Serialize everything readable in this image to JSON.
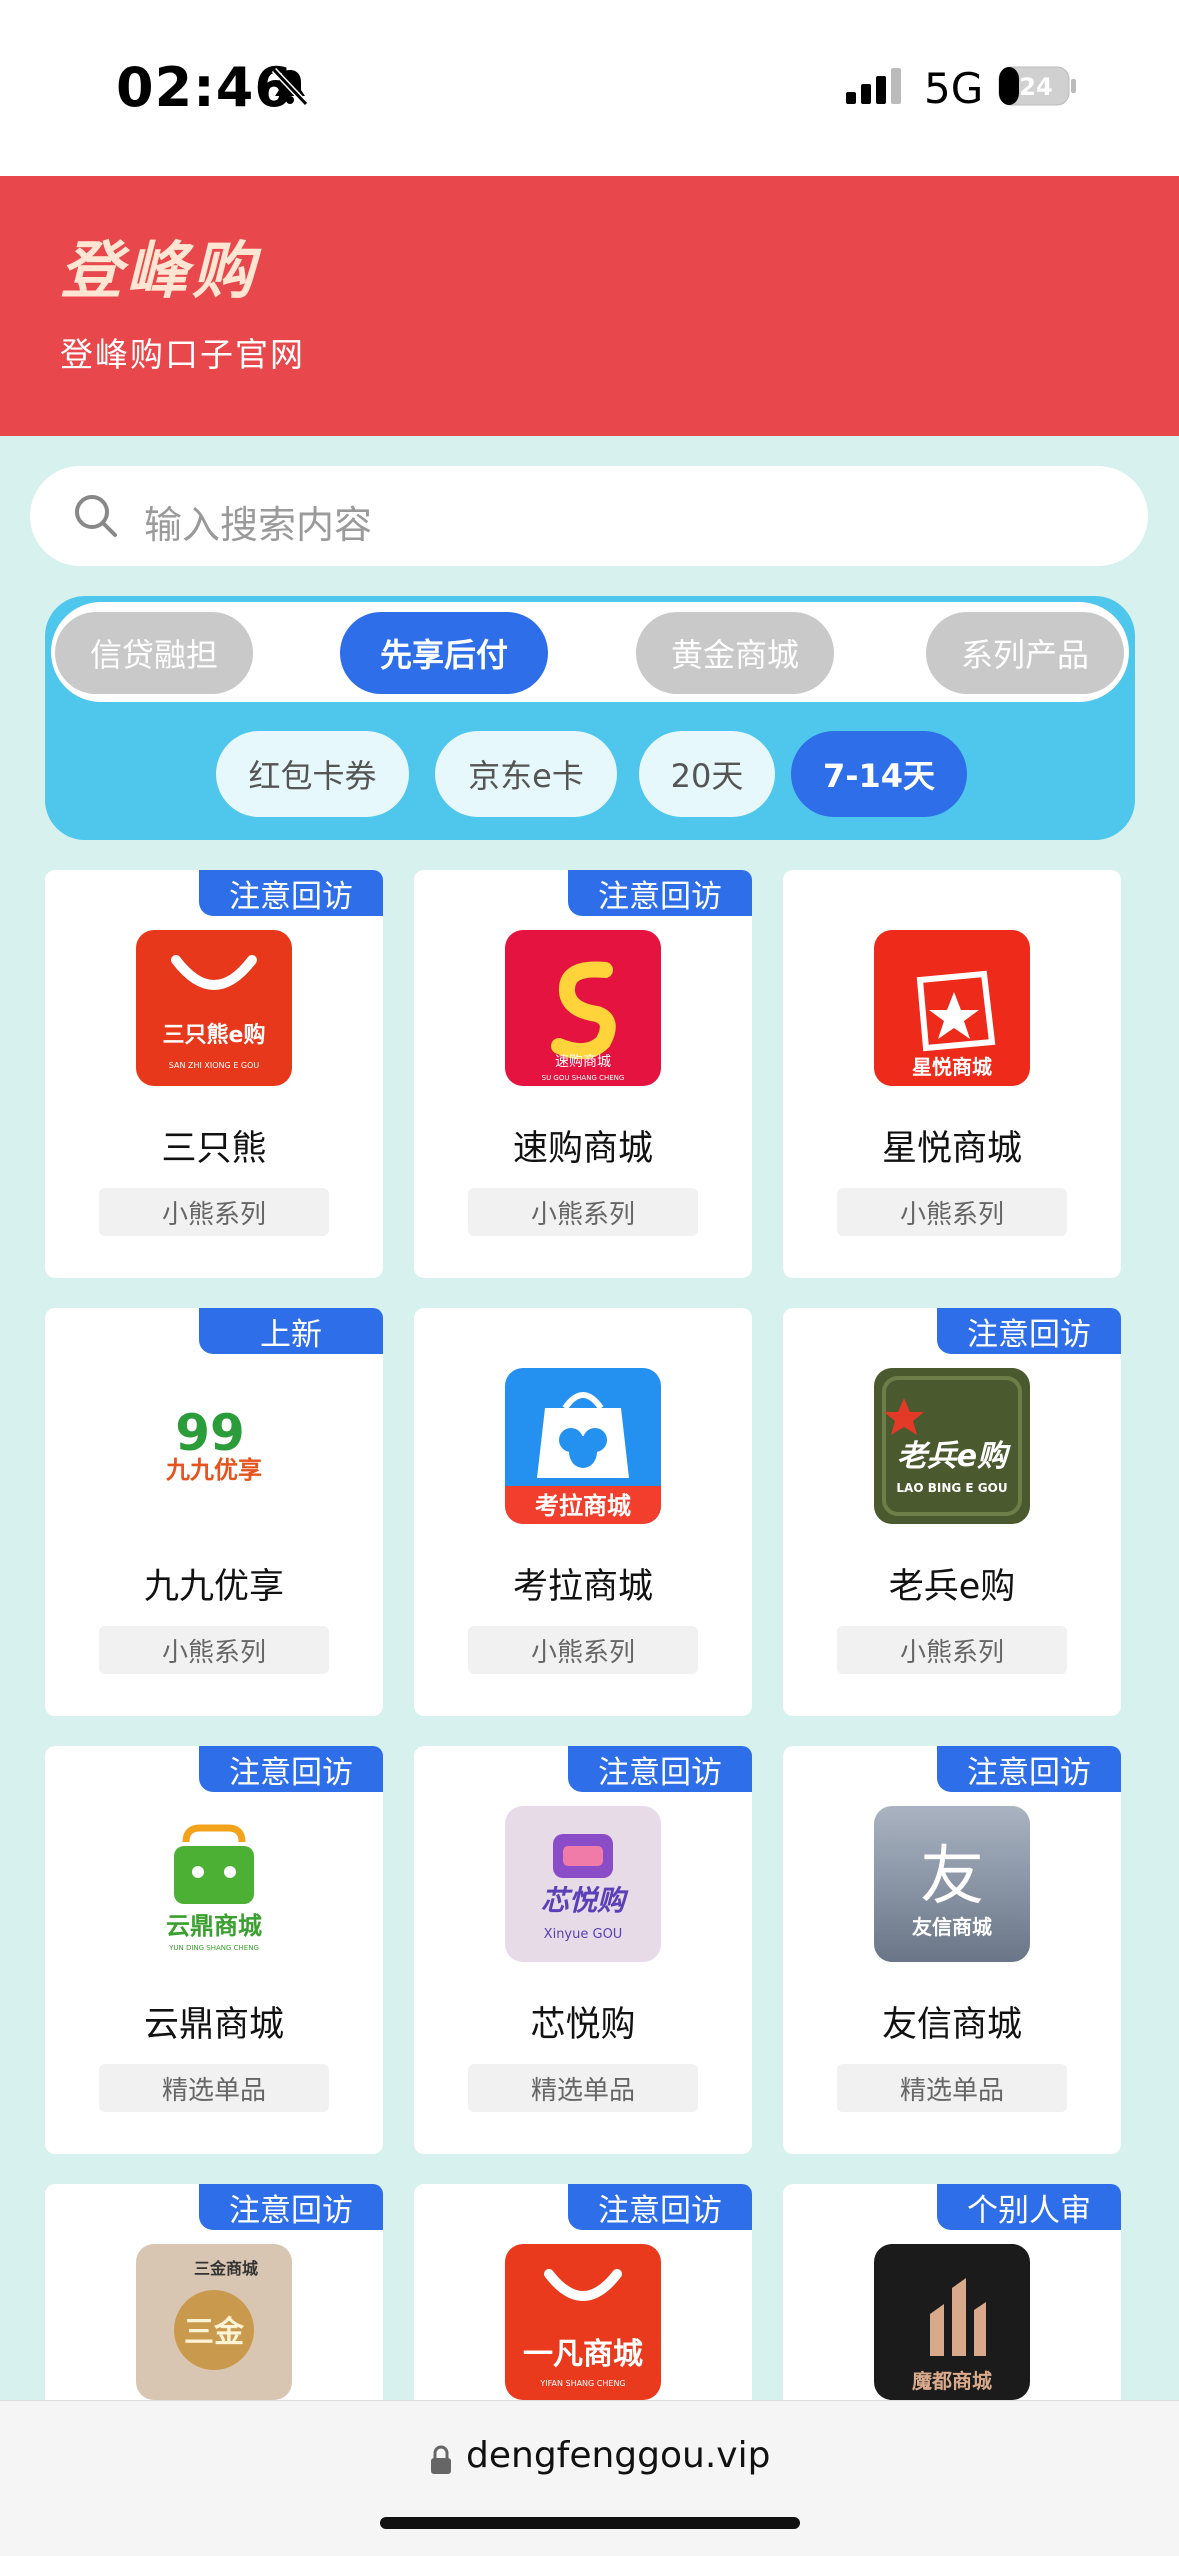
{
  "status_bar": {
    "time": "02:46",
    "network": "5G",
    "battery": "24"
  },
  "header": {
    "brand": "登峰购",
    "subtitle": "登峰购口子官网"
  },
  "search": {
    "placeholder": "输入搜索内容"
  },
  "tabs": [
    {
      "label": "信贷融担",
      "active": false
    },
    {
      "label": "先享后付",
      "active": true
    },
    {
      "label": "黄金商城",
      "active": false
    },
    {
      "label": "系列产品",
      "active": false
    }
  ],
  "subtabs": [
    {
      "label": "红包卡券",
      "active": false
    },
    {
      "label": "京东e卡",
      "active": false
    },
    {
      "label": "20天",
      "active": false
    },
    {
      "label": "7-14天",
      "active": true
    }
  ],
  "cards": [
    {
      "name": "三只熊",
      "tag": "注意回访",
      "series": "小熊系列",
      "logo_icon": "three-bears-logo-icon",
      "logo_text": "三只熊e购",
      "logo_sub": "SAN ZHI XIONG E GOU"
    },
    {
      "name": "速购商城",
      "tag": "注意回访",
      "series": "小熊系列",
      "logo_icon": "sugou-logo-icon",
      "logo_text": "速购商城",
      "logo_sub": "SU GOU SHANG CHENG"
    },
    {
      "name": "星悦商城",
      "tag": "",
      "series": "小熊系列",
      "logo_icon": "xingyue-logo-icon",
      "logo_text": "星悦商城"
    },
    {
      "name": "九九优享",
      "tag": "上新",
      "series": "小熊系列",
      "logo_icon": "jiujiu-logo-icon",
      "logo_text": "九九优享"
    },
    {
      "name": "考拉商城",
      "tag": "",
      "series": "小熊系列",
      "logo_icon": "koala-logo-icon",
      "logo_text": "考拉商城"
    },
    {
      "name": "老兵e购",
      "tag": "注意回访",
      "series": "小熊系列",
      "logo_icon": "laobing-logo-icon",
      "logo_text": "老兵e购",
      "logo_sub": "LAO BING E GOU"
    },
    {
      "name": "云鼎商城",
      "tag": "注意回访",
      "series": "精选单品",
      "logo_icon": "yunding-logo-icon",
      "logo_text": "云鼎商城",
      "logo_sub": "YUN DING SHANG CHENG"
    },
    {
      "name": "芯悦购",
      "tag": "注意回访",
      "series": "精选单品",
      "logo_icon": "xinyue-logo-icon",
      "logo_text": "芯悦购",
      "logo_sub": "Xinyue GOU"
    },
    {
      "name": "友信商城",
      "tag": "注意回访",
      "series": "精选单品",
      "logo_icon": "youxin-logo-icon",
      "logo_text": "友信商城"
    },
    {
      "name": "",
      "tag": "注意回访",
      "series": "",
      "logo_icon": "sanjin-logo-icon",
      "logo_text": "三金商城"
    },
    {
      "name": "",
      "tag": "注意回访",
      "series": "",
      "logo_icon": "yifan-logo-icon",
      "logo_text": "一凡商城",
      "logo_sub": "YIFAN SHANG CHENG"
    },
    {
      "name": "",
      "tag": "个别人审",
      "series": "",
      "logo_icon": "modu-logo-icon",
      "logo_text": "魔都商城"
    }
  ],
  "url_bar": {
    "url": "dengfenggou.vip"
  },
  "colors": {
    "header": "#e8474c",
    "accent": "#2e6ee8",
    "panel": "#4fc6eb",
    "background": "#d6f1ee"
  }
}
